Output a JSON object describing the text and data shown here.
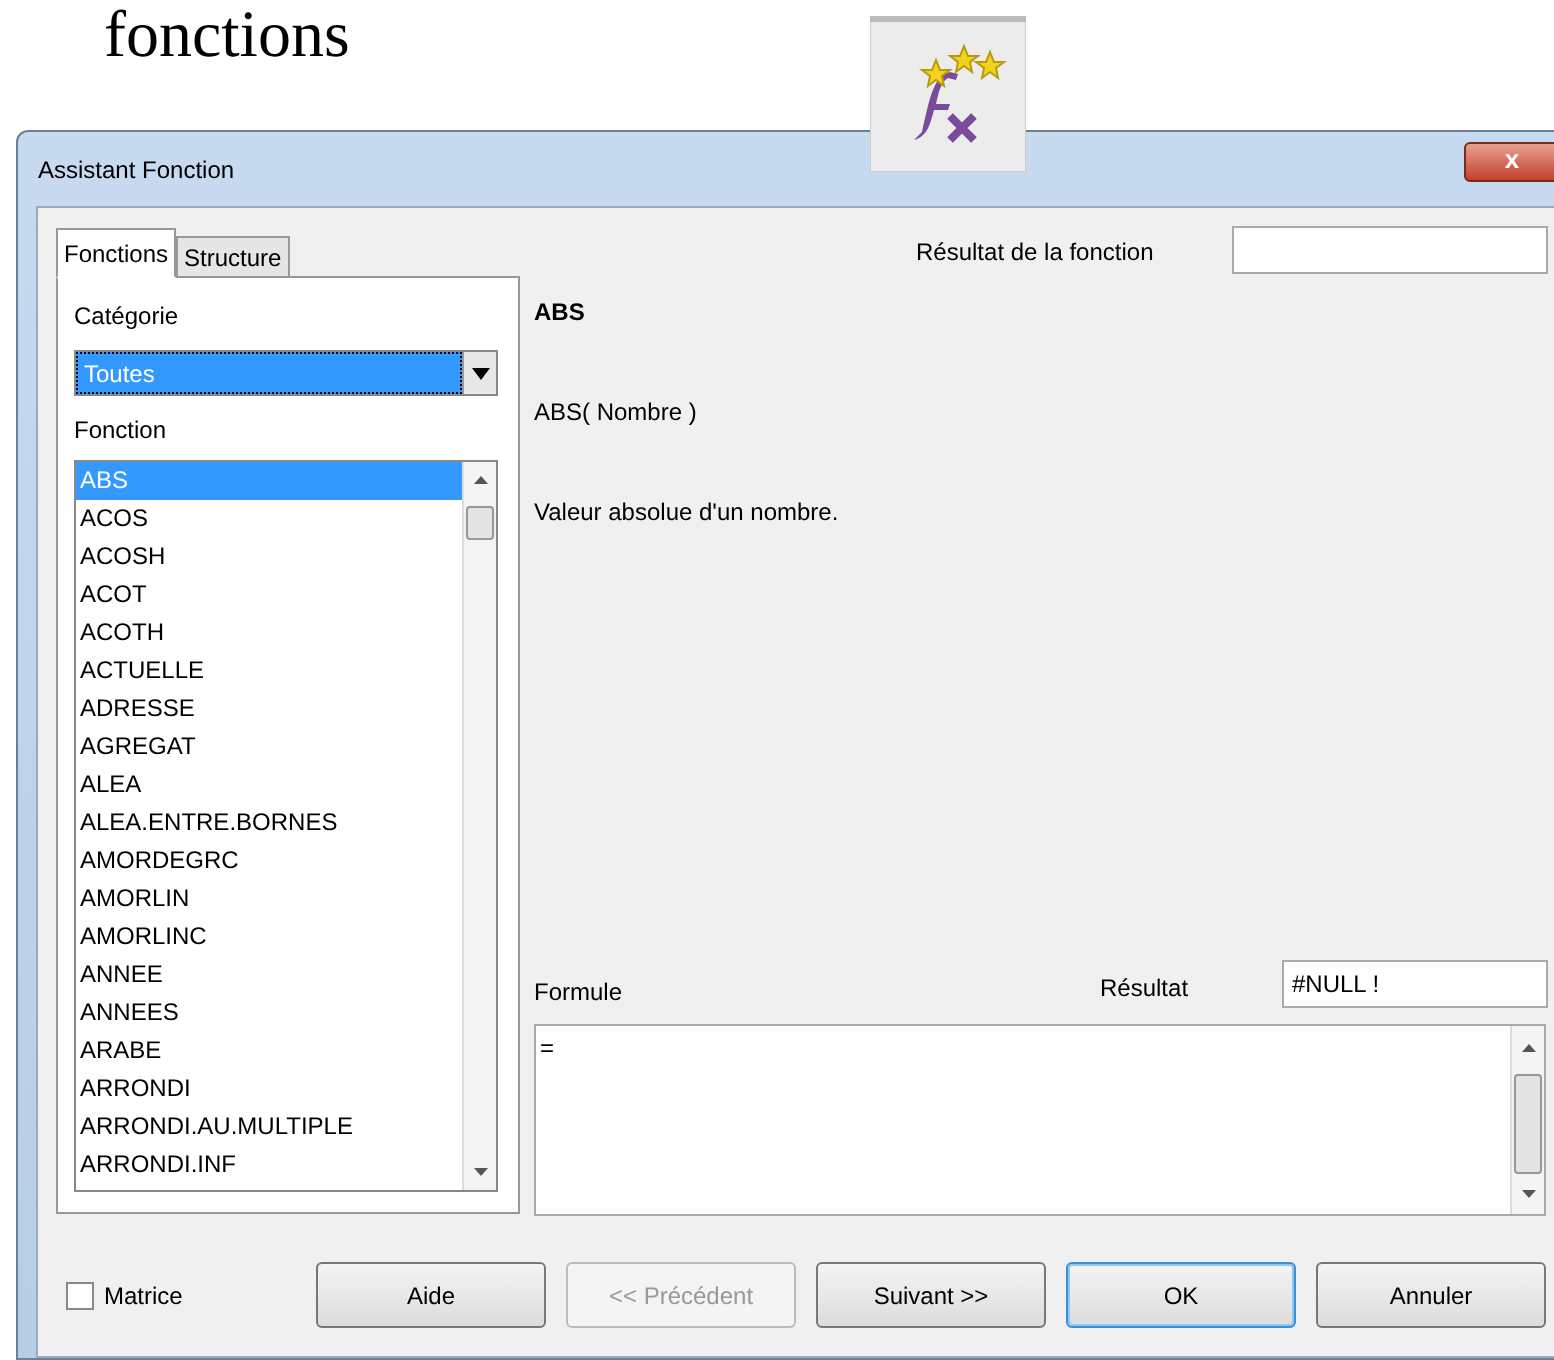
{
  "page_heading": "fonctions",
  "window": {
    "title": "Assistant Fonction",
    "close": "x"
  },
  "tabs": [
    {
      "label": "Fonctions",
      "selected": true
    },
    {
      "label": "Structure",
      "selected": false
    }
  ],
  "category": {
    "label": "Catégorie",
    "value": "Toutes"
  },
  "function_list": {
    "label": "Fonction",
    "items": [
      {
        "label": "ABS",
        "selected": true
      },
      {
        "label": "ACOS",
        "selected": false
      },
      {
        "label": "ACOSH",
        "selected": false
      },
      {
        "label": "ACOT",
        "selected": false
      },
      {
        "label": "ACOTH",
        "selected": false
      },
      {
        "label": "ACTUELLE",
        "selected": false
      },
      {
        "label": "ADRESSE",
        "selected": false
      },
      {
        "label": "AGREGAT",
        "selected": false
      },
      {
        "label": "ALEA",
        "selected": false
      },
      {
        "label": "ALEA.ENTRE.BORNES",
        "selected": false
      },
      {
        "label": "AMORDEGRC",
        "selected": false
      },
      {
        "label": "AMORLIN",
        "selected": false
      },
      {
        "label": "AMORLINC",
        "selected": false
      },
      {
        "label": "ANNEE",
        "selected": false
      },
      {
        "label": "ANNEES",
        "selected": false
      },
      {
        "label": "ARABE",
        "selected": false
      },
      {
        "label": "ARRONDI",
        "selected": false
      },
      {
        "label": "ARRONDI.AU.MULTIPLE",
        "selected": false
      },
      {
        "label": "ARRONDI.INF",
        "selected": false
      }
    ]
  },
  "function_result": {
    "label": "Résultat de la fonction"
  },
  "function_name": "ABS",
  "syntax": "ABS( Nombre )",
  "description": "Valeur absolue d'un nombre.",
  "formula": {
    "label": "Formule",
    "value": "="
  },
  "result": {
    "label": "Résultat",
    "value": "#NULL !"
  },
  "matrix": {
    "label": "Matrice",
    "checked": false
  },
  "buttons": [
    {
      "label": "Aide",
      "disabled": false,
      "default": false
    },
    {
      "label": "<< Précédent",
      "disabled": true,
      "default": false
    },
    {
      "label": "Suivant >>",
      "disabled": false,
      "default": false
    },
    {
      "label": "OK",
      "disabled": false,
      "default": true
    },
    {
      "label": "Annuler",
      "disabled": false,
      "default": false
    }
  ]
}
